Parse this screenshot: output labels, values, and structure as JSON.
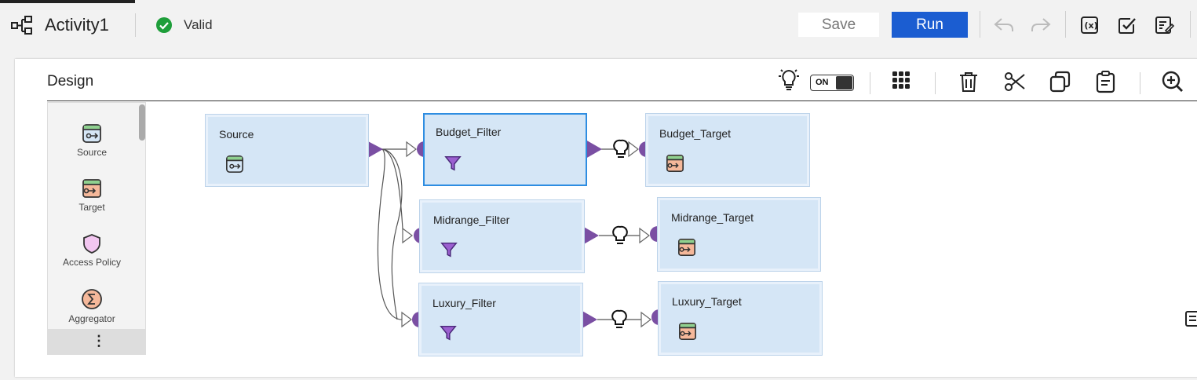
{
  "header": {
    "title": "Activity1",
    "status": "Valid",
    "save_label": "Save",
    "run_label": "Run",
    "icons": [
      "workflow-icon",
      "check-circle-icon",
      "undo-icon",
      "redo-icon",
      "variables-icon",
      "validate-icon",
      "properties-icon"
    ]
  },
  "design": {
    "title": "Design",
    "toggle_label": "ON",
    "toolbar_icons": [
      "lightbulb-icon",
      "grid-icon",
      "delete-icon",
      "cut-icon",
      "copy-icon",
      "paste-icon",
      "zoom-in-icon"
    ]
  },
  "palette": {
    "items": [
      {
        "label": "Source",
        "icon": "source-icon"
      },
      {
        "label": "Target",
        "icon": "target-icon"
      },
      {
        "label": "Access Policy",
        "icon": "shield-icon"
      },
      {
        "label": "Aggregator",
        "icon": "sigma-icon"
      }
    ],
    "more_label": "⋮"
  },
  "canvas": {
    "nodes": {
      "source": "Source",
      "budget_filter": "Budget_Filter",
      "budget_target": "Budget_Target",
      "midrange_filter": "Midrange_Filter",
      "midrange_target": "Midrange_Target",
      "luxury_filter": "Luxury_Filter",
      "luxury_target": "Luxury_Target"
    }
  },
  "colors": {
    "run_button": "#1b5dd1",
    "node_fill": "#d5e6f6",
    "node_selected_border": "#2e8de1",
    "port": "#7a4fa3",
    "valid": "#1e9e3a"
  }
}
